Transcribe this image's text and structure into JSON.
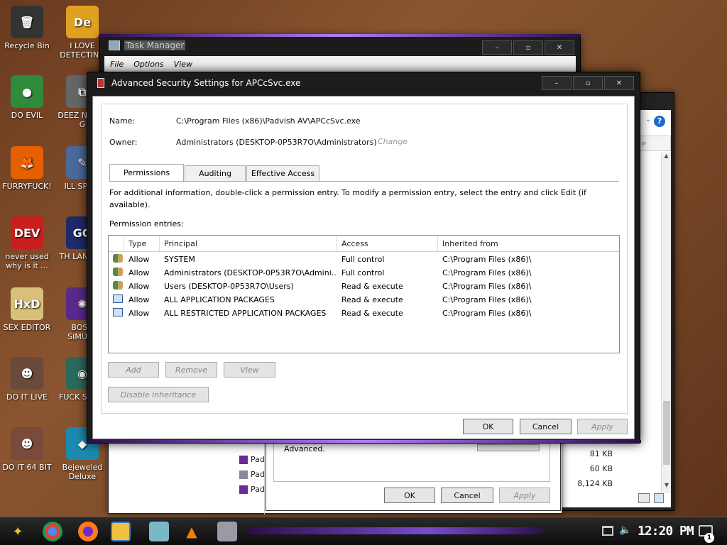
{
  "desktop_icons": [
    {
      "label": "Recycle Bin",
      "icon": "recycle-bin-icon",
      "glyph": "🗑",
      "bg": "#333"
    },
    {
      "label": "I LOVE DETECTING",
      "icon": "detect-it-easy-icon",
      "glyph": "De",
      "bg": "#e0a020"
    },
    {
      "label": "DO EVIL",
      "icon": "chrome-icon",
      "glyph": "●",
      "bg": "#2f8a3c"
    },
    {
      "label": "DEEZ N HAH G",
      "icon": "copy-icon",
      "glyph": "⧉",
      "bg": "#666"
    },
    {
      "label": "FURRYFUCK!",
      "icon": "firefox-icon",
      "glyph": "🦊",
      "bg": "#e66000"
    },
    {
      "label": "ILL SP YO",
      "icon": "tool-icon",
      "glyph": "✎",
      "bg": "#4a6a9a"
    },
    {
      "label": "never used why is it ...",
      "icon": "dev-cpp-icon",
      "glyph": "DEV",
      "bg": "#c81e1e"
    },
    {
      "label": "TH LANGUA",
      "icon": "ide-icon",
      "glyph": "GO",
      "bg": "#1e2a6a"
    },
    {
      "label": "SEX EDITOR",
      "icon": "hxd-icon",
      "glyph": "HxD",
      "bg": "#d9c07a"
    },
    {
      "label": "BOSN SIMULA",
      "icon": "purple-virus-icon",
      "glyph": "✺",
      "bg": "#5a2a8a"
    },
    {
      "label": "DO IT LIVE",
      "icon": "portrait-icon",
      "glyph": "☻",
      "bg": "#6a4a3a"
    },
    {
      "label": "FUCK S ELVI",
      "icon": "globe-icon",
      "glyph": "◉",
      "bg": "#2a6a5a"
    },
    {
      "label": "DO IT 64 BIT",
      "icon": "portrait-64-icon",
      "glyph": "☻",
      "bg": "#7a4a3a"
    },
    {
      "label": "Bejeweled Deluxe",
      "icon": "diamond-icon",
      "glyph": "◆",
      "bg": "#1a8ab0"
    }
  ],
  "task_manager": {
    "title": "Task Manager",
    "menu": [
      "File",
      "Options",
      "View"
    ]
  },
  "dialog": {
    "title": "Advanced Security Settings for APCcSvc.exe",
    "name_label": "Name:",
    "name_value": "C:\\Program Files (x86)\\Padvish AV\\APCcSvc.exe",
    "owner_label": "Owner:",
    "owner_value": "Administrators (DESKTOP-0P53R7O\\Administrators)",
    "change_link": "Change",
    "tabs": [
      "Permissions",
      "Auditing",
      "Effective Access"
    ],
    "info_text": "For additional information, double-click a permission entry. To modify a permission entry, select the entry and click Edit (if available).",
    "entries_label": "Permission entries:",
    "columns": [
      "Type",
      "Principal",
      "Access",
      "Inherited from"
    ],
    "entries": [
      {
        "icon": "user-group-icon",
        "type": "Allow",
        "principal": "SYSTEM",
        "access": "Full control",
        "inherited": "C:\\Program Files (x86)\\"
      },
      {
        "icon": "user-group-icon",
        "type": "Allow",
        "principal": "Administrators (DESKTOP-0P53R7O\\Admini...",
        "access": "Full control",
        "inherited": "C:\\Program Files (x86)\\"
      },
      {
        "icon": "user-group-icon",
        "type": "Allow",
        "principal": "Users (DESKTOP-0P53R7O\\Users)",
        "access": "Read & execute",
        "inherited": "C:\\Program Files (x86)\\"
      },
      {
        "icon": "app-package-icon",
        "type": "Allow",
        "principal": "ALL APPLICATION PACKAGES",
        "access": "Read & execute",
        "inherited": "C:\\Program Files (x86)\\"
      },
      {
        "icon": "app-package-icon",
        "type": "Allow",
        "principal": "ALL RESTRICTED APPLICATION PACKAGES",
        "access": "Read & execute",
        "inherited": "C:\\Program Files (x86)\\"
      }
    ],
    "add_label": "Add",
    "remove_label": "Remove",
    "view_label": "View",
    "disable_inheritance_label": "Disable inheritance",
    "ok_label": "OK",
    "cancel_label": "Cancel",
    "apply_label": "Apply"
  },
  "behind_dialog": {
    "advanced_text": "Advanced.",
    "ok_label": "OK",
    "cancel_label": "Cancel",
    "apply_label": "Apply"
  },
  "file_sizes": [
    "81 KB",
    "60 KB",
    "8,124 KB"
  ],
  "file_prefix": "Pad",
  "taskbar": {
    "clock": "12:20 PM",
    "notification_count": "1"
  }
}
